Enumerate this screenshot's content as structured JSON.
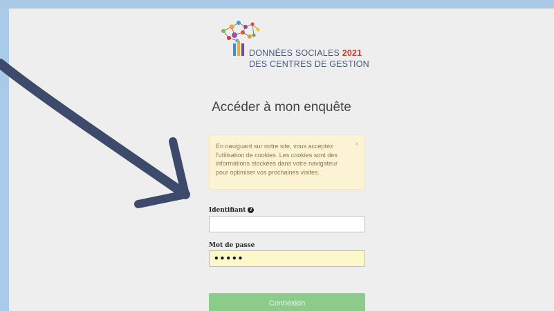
{
  "logo": {
    "line1": "DONNÉES SOCIALES",
    "year": "2021",
    "line2": "DES CENTRES DE GESTION"
  },
  "page": {
    "title": "Accéder à mon enquête"
  },
  "cookie_notice": {
    "text": "En naviguant sur notre site, vous acceptez l'utilisation de cookies. Les cookies sont des informations stockées dans votre navigateur pour optimiser vos prochaines visites.",
    "close": "×"
  },
  "login": {
    "username_label": "Identifiant",
    "help_icon": "?",
    "username_value": "",
    "password_label": "Mot de passe",
    "password_value": "•••••",
    "submit_label": "Connexion"
  },
  "colors": {
    "frame": "#a9cbe8",
    "button": "#8dcb8b",
    "annotation_arrow": "#3d4a6b",
    "year": "#d23a2f"
  }
}
